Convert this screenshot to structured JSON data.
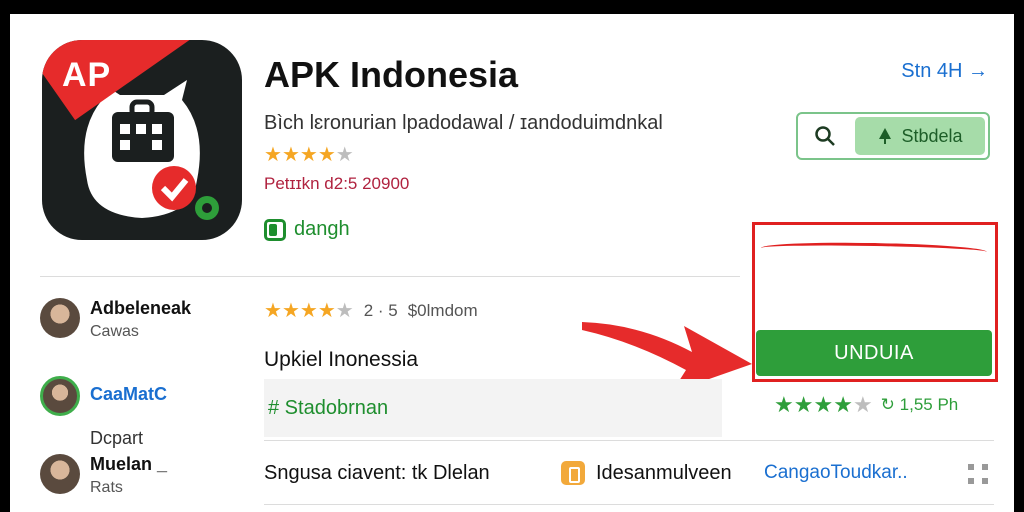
{
  "app": {
    "title": "APK Indonesia",
    "subtitle": "Bìch lɛronurian lpadodawal / ɪandoduimdnkal",
    "rating_stars": 3.5,
    "release": "Petɪɪkn d2:5 20900",
    "tag": "dangh",
    "icon_ribbon_text": "AP"
  },
  "header": {
    "top_link": "Stn 4H →",
    "share_label": "Stbdela"
  },
  "download": {
    "label": "UNDUIA"
  },
  "sidebar": {
    "users": [
      {
        "name": "Adbeleneak",
        "sub": "Cawas"
      },
      {
        "name": "CaaMatC",
        "sub": ""
      },
      {
        "name": "Muelan _",
        "sub": "Rats"
      }
    ],
    "lone_sub": "Dcpart"
  },
  "main": {
    "rating_stars": 3.5,
    "rating_meta_1": "2 · 5",
    "rating_meta_2": "$0lmdom",
    "section_title": "Upkiel Inonessia",
    "tag_row": "# Stadobrnan",
    "score_stars": 4.5,
    "score_meta": "↻ 1,55 Ph",
    "bottom_text": "Sngusa ciavent: tk Dlelan",
    "bottom_mid": "Idesanmulveen",
    "bottom_link": "CangaoToudkar.."
  },
  "colors": {
    "green": "#2e9e3a",
    "red": "#e02020",
    "link_blue": "#1a6fd0",
    "star_gold": "#f5a623"
  }
}
